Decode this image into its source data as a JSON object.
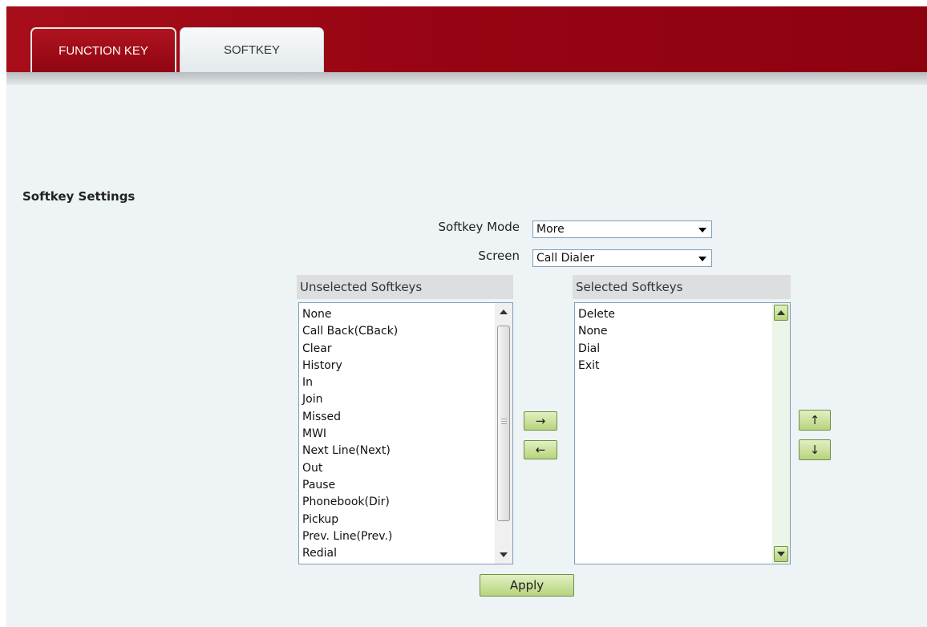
{
  "tabs": [
    {
      "label": "FUNCTION KEY",
      "active": true
    },
    {
      "label": "SOFTKEY",
      "active": false
    }
  ],
  "section_title": "Softkey Settings",
  "softkey_mode": {
    "label": "Softkey Mode",
    "value": "More"
  },
  "screen": {
    "label": "Screen",
    "value": "Call Dialer"
  },
  "unselected": {
    "header": "Unselected Softkeys",
    "items": [
      "None",
      "Call Back(CBack)",
      "Clear",
      "History",
      "In",
      "Join",
      "Missed",
      "MWI",
      "Next Line(Next)",
      "Out",
      "Pause",
      "Phonebook(Dir)",
      "Pickup",
      "Prev. Line(Prev.)",
      "Redial"
    ]
  },
  "selected": {
    "header": "Selected Softkeys",
    "items": [
      "Delete",
      "None",
      "Dial",
      "Exit"
    ]
  },
  "buttons": {
    "move_right": "→",
    "move_left": "←",
    "move_up": "↑",
    "move_down": "↓",
    "apply": "Apply"
  },
  "colors": {
    "header_red": "#970413",
    "page_bg": "#eef3f5",
    "button_green": "#b6d47c",
    "list_border": "#7f9db9"
  }
}
